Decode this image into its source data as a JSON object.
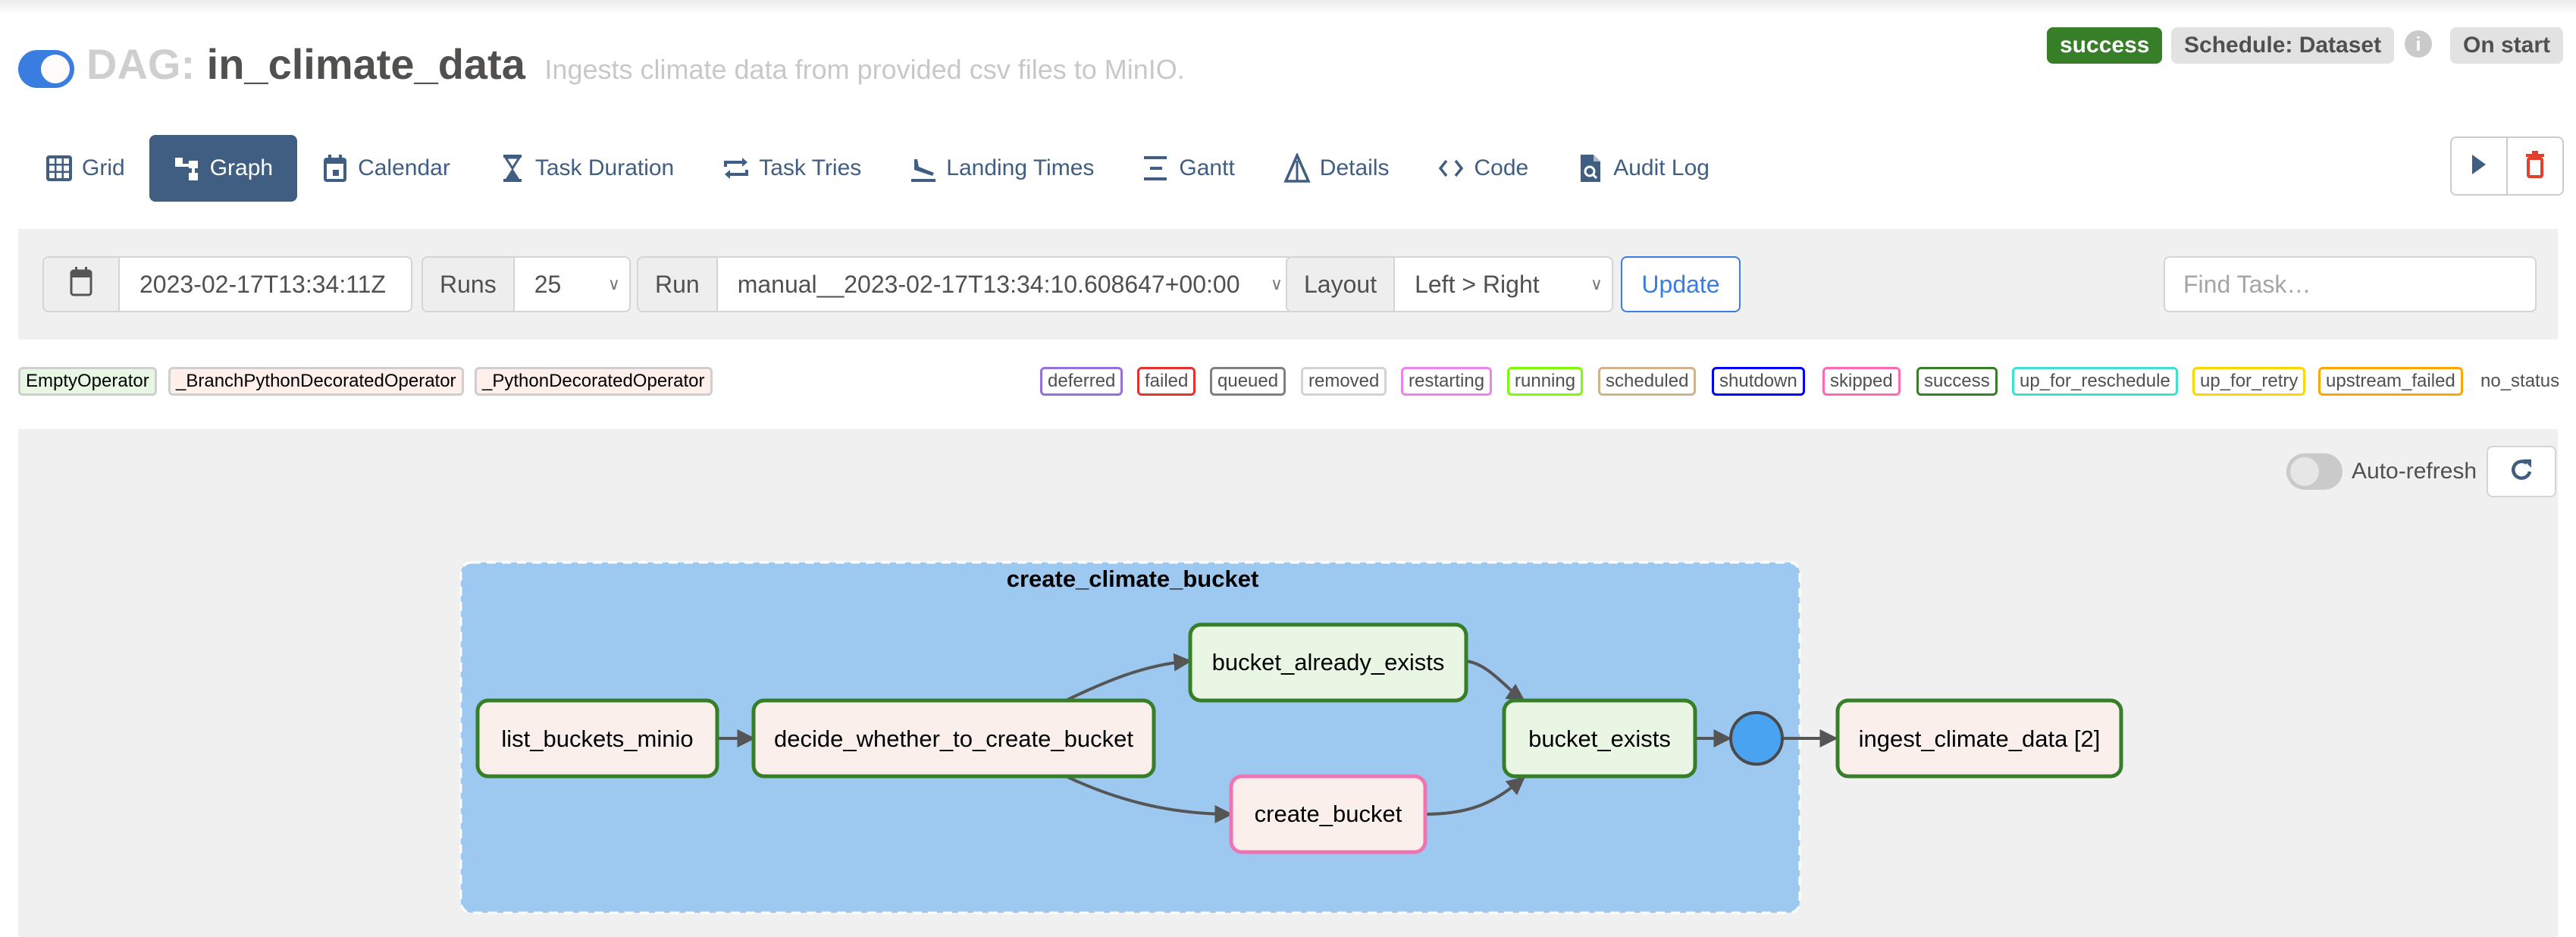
{
  "header": {
    "dag_prefix": "DAG:",
    "dag_id": "in_climate_data",
    "description": "Ingests climate data from provided csv files to MinIO.",
    "paused": false,
    "state_badge": "success",
    "schedule_badge": "Schedule: Dataset",
    "info_icon": "i",
    "trigger_badge": "On start",
    "colors": {
      "state": "#367e27",
      "toggle": "#3a7de0"
    }
  },
  "tabs": [
    {
      "label": "Grid",
      "icon": "grid-icon",
      "active": false
    },
    {
      "label": "Graph",
      "icon": "graph-icon",
      "active": true
    },
    {
      "label": "Calendar",
      "icon": "calendar-icon",
      "active": false
    },
    {
      "label": "Task Duration",
      "icon": "hourglass-icon",
      "active": false
    },
    {
      "label": "Task Tries",
      "icon": "retry-arrows-icon",
      "active": false
    },
    {
      "label": "Landing Times",
      "icon": "plane-landing-icon",
      "active": false
    },
    {
      "label": "Gantt",
      "icon": "gantt-icon",
      "active": false
    },
    {
      "label": "Details",
      "icon": "delta-icon",
      "active": false
    },
    {
      "label": "Code",
      "icon": "code-icon",
      "active": false
    },
    {
      "label": "Audit Log",
      "icon": "file-search-icon",
      "active": false
    }
  ],
  "actions": {
    "trigger": "play-icon",
    "delete": "trash-icon"
  },
  "toolbar": {
    "base_date": "2023-02-17T13:34:11Z",
    "runs_label": "Runs",
    "runs_value": "25",
    "run_label": "Run",
    "run_value": "manual__2023-02-17T13:34:10.608647+00:00",
    "layout_label": "Layout",
    "layout_value": "Left > Right",
    "update_label": "Update",
    "find_task_placeholder": "Find Task…"
  },
  "legend": {
    "operators": [
      {
        "label": "EmptyOperator",
        "bg": "#e8f7e4"
      },
      {
        "label": "_BranchPythonDecoratedOperator",
        "bg": "#ffefeb"
      },
      {
        "label": "_PythonDecoratedOperator",
        "bg": "#ffefeb"
      }
    ],
    "states": [
      {
        "label": "deferred",
        "color": "#9370db"
      },
      {
        "label": "failed",
        "color": "#e8312a"
      },
      {
        "label": "queued",
        "color": "#808080"
      },
      {
        "label": "removed",
        "color": "#d3d3d3"
      },
      {
        "label": "restarting",
        "color": "#ee82ee"
      },
      {
        "label": "running",
        "color": "#7cfc00"
      },
      {
        "label": "scheduled",
        "color": "#d2b48c"
      },
      {
        "label": "shutdown",
        "color": "#0000ff"
      },
      {
        "label": "skipped",
        "color": "#ff69b4"
      },
      {
        "label": "success",
        "color": "#367e27"
      },
      {
        "label": "up_for_reschedule",
        "color": "#40e0d0"
      },
      {
        "label": "up_for_retry",
        "color": "#ffd700"
      },
      {
        "label": "upstream_failed",
        "color": "#ffa500"
      }
    ],
    "no_status": "no_status"
  },
  "graph": {
    "auto_refresh_label": "Auto-refresh",
    "auto_refresh_on": false,
    "cluster": {
      "label": "create_climate_bucket",
      "color": "#9dc9f1"
    },
    "nodes": [
      {
        "id": "list_buckets_minio",
        "label": "list_buckets_minio",
        "state": "success",
        "operator": "_PythonDecoratedOperator"
      },
      {
        "id": "decide_whether_to_create_bucket",
        "label": "decide_whether_to_create_bucket",
        "state": "success",
        "operator": "_BranchPythonDecoratedOperator"
      },
      {
        "id": "bucket_already_exists",
        "label": "bucket_already_exists",
        "state": "success",
        "operator": "EmptyOperator"
      },
      {
        "id": "create_bucket",
        "label": "create_bucket",
        "state": "skipped",
        "operator": "_PythonDecoratedOperator"
      },
      {
        "id": "bucket_exists",
        "label": "bucket_exists",
        "state": "success",
        "operator": "EmptyOperator"
      },
      {
        "id": "join",
        "label": "",
        "state": "join",
        "operator": ""
      },
      {
        "id": "ingest_climate_data",
        "label": "ingest_climate_data [2]",
        "state": "success",
        "operator": "_PythonDecoratedOperator"
      }
    ],
    "edges": [
      [
        "list_buckets_minio",
        "decide_whether_to_create_bucket"
      ],
      [
        "decide_whether_to_create_bucket",
        "bucket_already_exists"
      ],
      [
        "decide_whether_to_create_bucket",
        "create_bucket"
      ],
      [
        "bucket_already_exists",
        "bucket_exists"
      ],
      [
        "create_bucket",
        "bucket_exists"
      ],
      [
        "bucket_exists",
        "join"
      ],
      [
        "join",
        "ingest_climate_data"
      ]
    ]
  }
}
